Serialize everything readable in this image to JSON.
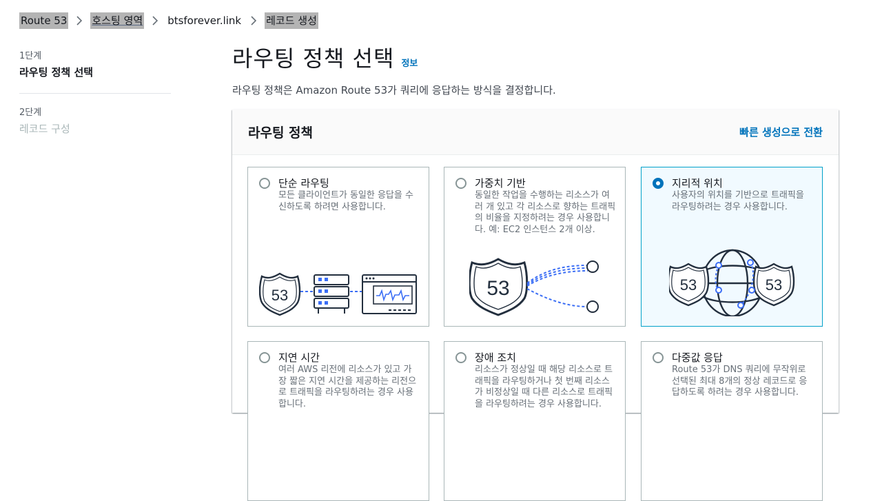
{
  "breadcrumb": {
    "items": [
      "Route 53",
      "호스팅 영역",
      "btsforever.link",
      "레코드 생성"
    ]
  },
  "steps": [
    {
      "number": "1단계",
      "title": "라우팅 정책 선택"
    },
    {
      "number": "2단계",
      "title": "레코드 구성"
    }
  ],
  "page": {
    "title": "라우팅 정책 선택",
    "info": "정보",
    "description": "라우팅 정책은 Amazon Route 53가 쿼리에 응답하는 방식을 결정합니다."
  },
  "panel": {
    "title": "라우팅 정책",
    "switch_link": "빠른 생성으로 전환"
  },
  "policies": [
    {
      "title": "단순 라우팅",
      "desc": "모든 클라이언트가 동일한 응답을 수신하도록 하려면 사용합니다.",
      "selected": false
    },
    {
      "title": "가중치 기반",
      "desc": "동일한 작업을 수행하는 리소스가 여러 개 있고 각 리소스로 향하는 트래픽의 비율을 지정하려는 경우 사용합니다. 예: EC2 인스턴스 2개 이상.",
      "selected": false
    },
    {
      "title": "지리적 위치",
      "desc": "사용자의 위치를 기반으로 트래픽을 라우팅하려는 경우 사용합니다.",
      "selected": true
    },
    {
      "title": "지연 시간",
      "desc": "여러 AWS 리전에 리소스가 있고 가장 짧은 지연 시간을 제공하는 리전으로 트래픽을 라우팅하려는 경우 사용합니다.",
      "selected": false
    },
    {
      "title": "장애 조치",
      "desc": "리소스가 정상일 때 해당 리소스로 트래픽을 라우팅하거나 첫 번째 리소스가 비정상일 때 다른 리소스로 트래픽을 라우팅하려는 경우 사용합니다.",
      "selected": false
    },
    {
      "title": "다중값 응답",
      "desc": "Route 53가 DNS 쿼리에 무작위로 선택된 최대 8개의 정상 레코드로 응답하도록 하려는 경우 사용합니다.",
      "selected": false
    }
  ],
  "illustrations": {
    "shield_number": "53"
  },
  "colors": {
    "accent": "#0073bb",
    "selected_border": "#00a1c9",
    "selected_bg": "#f1faff",
    "illustration_line": "#232f3e",
    "illustration_accent": "#3b6ef5"
  }
}
